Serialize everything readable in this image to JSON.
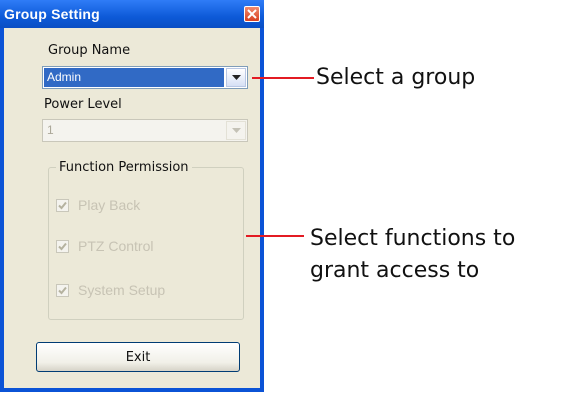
{
  "window": {
    "title": "Group Setting",
    "accent": "#0b53d6"
  },
  "group_name": {
    "label": "Group Name",
    "value": "Admin"
  },
  "power_level": {
    "label": "Power Level",
    "value": "1"
  },
  "function_permission": {
    "label": "Function Permission",
    "items": [
      {
        "label": "Play Back",
        "checked": true
      },
      {
        "label": "PTZ Control",
        "checked": true
      },
      {
        "label": "System Setup",
        "checked": true
      }
    ]
  },
  "buttons": {
    "exit": "Exit"
  },
  "annotations": {
    "select_group": "Select a group",
    "select_functions_line1": "Select functions to",
    "select_functions_line2": "grant access to",
    "color": "#e31b23"
  },
  "icons": [
    "close-icon",
    "chevron-down-icon",
    "checkmark-icon"
  ]
}
